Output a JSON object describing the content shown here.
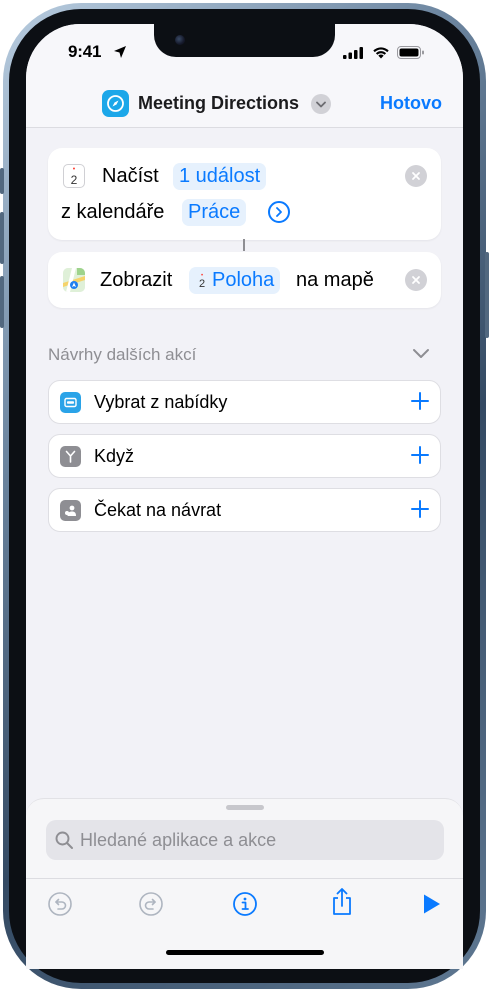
{
  "status_bar": {
    "time": "9:41"
  },
  "header": {
    "title": "Meeting Directions",
    "done_label": "Hotovo",
    "app_icon": "compass-icon"
  },
  "actions": [
    {
      "name": "get-events",
      "icon": "calendar-icon",
      "icon_day": "2",
      "verb": "Načíst",
      "param_count": "1 událost",
      "line2_text": "z kalendáře",
      "param_calendar": "Práce"
    },
    {
      "name": "show-map",
      "icon": "maps-icon",
      "verb": "Zobrazit",
      "param_icon_day": "2",
      "param_location": "Poloha",
      "suffix": "na mapě"
    }
  ],
  "suggestions": {
    "header": "Návrhy dalších akcí",
    "items": [
      {
        "label": "Vybrat z nabídky",
        "icon": "menu-icon",
        "color": "#2aa3e8"
      },
      {
        "label": "Když",
        "icon": "branch-icon",
        "color": "#8e8e93"
      },
      {
        "label": "Čekat na návrat",
        "icon": "person-return-icon",
        "color": "#8e8e93"
      }
    ]
  },
  "search": {
    "placeholder": "Hledané aplikace a akce"
  },
  "toolbar": {
    "buttons": [
      "undo-icon",
      "redo-icon",
      "info-icon",
      "share-icon",
      "play-icon"
    ]
  },
  "colors": {
    "accent": "#0a7aff",
    "pill_bg": "#e6f1fd",
    "background": "#f2f2f7"
  }
}
